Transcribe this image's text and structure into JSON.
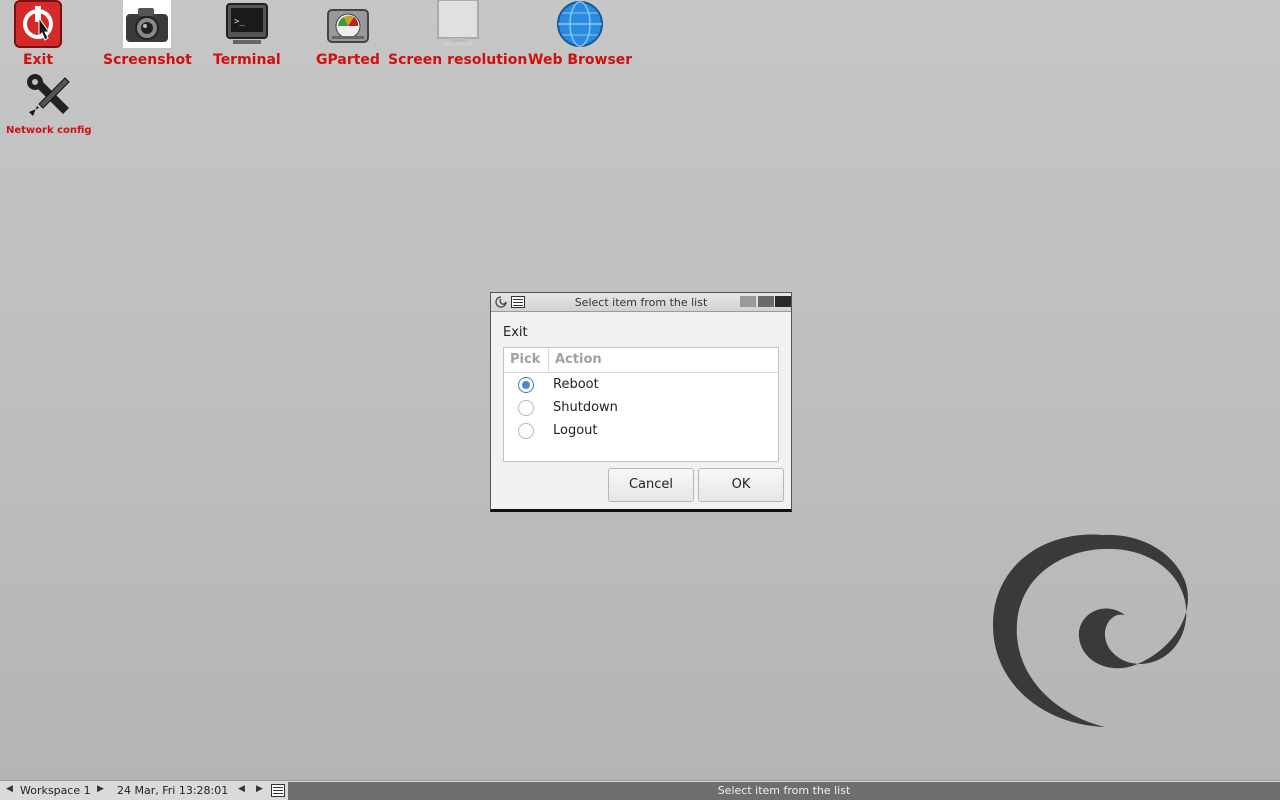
{
  "desktop": {
    "icons": [
      {
        "label": "Exit"
      },
      {
        "label": "Screenshot"
      },
      {
        "label": "Terminal"
      },
      {
        "label": "GParted"
      },
      {
        "label": "Screen resolution"
      },
      {
        "label": "Web Browser"
      },
      {
        "label": "Network config"
      }
    ]
  },
  "dialog": {
    "title": "Select item from the list",
    "prompt": "Exit",
    "columns": [
      "Pick",
      "Action"
    ],
    "items": [
      {
        "label": "Reboot",
        "selected": true
      },
      {
        "label": "Shutdown",
        "selected": false
      },
      {
        "label": "Logout",
        "selected": false
      }
    ],
    "buttons": {
      "cancel": "Cancel",
      "ok": "OK"
    }
  },
  "taskbar": {
    "workspace": "Workspace 1",
    "clock": "24 Mar, Fri 13:28:01",
    "active_task": "Select item from the list"
  },
  "colors": {
    "icon_label": "#d01010",
    "radio_selected": "#4a8ad0",
    "desktop_bg": "#c0c0c0"
  }
}
